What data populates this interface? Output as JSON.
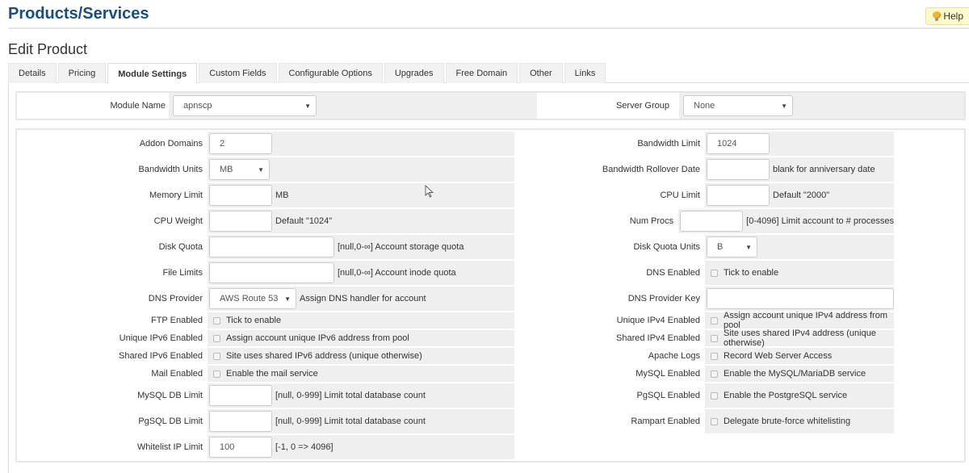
{
  "header": {
    "title": "Products/Services",
    "help_label": "Help",
    "subtitle": "Edit Product"
  },
  "tabs": [
    {
      "label": "Details",
      "active": false
    },
    {
      "label": "Pricing",
      "active": false
    },
    {
      "label": "Module Settings",
      "active": true
    },
    {
      "label": "Custom Fields",
      "active": false
    },
    {
      "label": "Configurable Options",
      "active": false
    },
    {
      "label": "Upgrades",
      "active": false
    },
    {
      "label": "Free Domain",
      "active": false
    },
    {
      "label": "Other",
      "active": false
    },
    {
      "label": "Links",
      "active": false
    }
  ],
  "module": {
    "module_name_label": "Module Name",
    "module_name_value": "apnscp",
    "server_group_label": "Server Group",
    "server_group_value": "None"
  },
  "left_fields": {
    "addon_domains": {
      "label": "Addon Domains",
      "value": "2"
    },
    "bandwidth_units": {
      "label": "Bandwidth Units",
      "value": "MB"
    },
    "memory_limit": {
      "label": "Memory Limit",
      "value": "",
      "hint": "MB"
    },
    "cpu_weight": {
      "label": "CPU Weight",
      "value": "",
      "hint": "Default \"1024\""
    },
    "disk_quota": {
      "label": "Disk Quota",
      "value": "",
      "hint": "[null,0-∞] Account storage quota"
    },
    "file_limits": {
      "label": "File Limits",
      "value": "",
      "hint": "[null,0-∞] Account inode quota"
    },
    "dns_provider": {
      "label": "DNS Provider",
      "value": "AWS Route 53",
      "hint": "Assign DNS handler for account"
    },
    "ftp_enabled": {
      "label": "FTP Enabled",
      "checked": false,
      "hint": "Tick to enable"
    },
    "unique_ipv6": {
      "label": "Unique IPv6 Enabled",
      "checked": false,
      "hint": "Assign account unique IPv6 address from pool"
    },
    "shared_ipv6": {
      "label": "Shared IPv6 Enabled",
      "checked": false,
      "hint": "Site uses shared IPv6 address (unique otherwise)"
    },
    "mail_enabled": {
      "label": "Mail Enabled",
      "checked": false,
      "hint": "Enable the mail service"
    },
    "mysql_db_limit": {
      "label": "MySQL DB Limit",
      "value": "",
      "hint": "[null, 0-999] Limit total database count"
    },
    "pgsql_db_limit": {
      "label": "PgSQL DB Limit",
      "value": "",
      "hint": "[null, 0-999] Limit total database count"
    },
    "whitelist_ip_limit": {
      "label": "Whitelist IP Limit",
      "value": "100",
      "hint": "[-1, 0 => 4096]"
    }
  },
  "right_fields": {
    "bandwidth_limit": {
      "label": "Bandwidth Limit",
      "value": "1024"
    },
    "bandwidth_rollover": {
      "label": "Bandwidth Rollover Date",
      "value": "",
      "hint": "blank for anniversary date"
    },
    "cpu_limit": {
      "label": "CPU Limit",
      "value": "",
      "hint": "Default \"2000\""
    },
    "num_procs": {
      "label": "Num Procs",
      "value": "",
      "hint": "[0-4096] Limit account to # processes"
    },
    "disk_quota_units": {
      "label": "Disk Quota Units",
      "value": "B"
    },
    "dns_enabled": {
      "label": "DNS Enabled",
      "checked": false,
      "hint": "Tick to enable"
    },
    "dns_provider_key": {
      "label": "DNS Provider Key",
      "value": ""
    },
    "unique_ipv4": {
      "label": "Unique IPv4 Enabled",
      "checked": false,
      "hint": "Assign account unique IPv4 address from pool"
    },
    "shared_ipv4": {
      "label": "Shared IPv4 Enabled",
      "checked": false,
      "hint": "Site uses shared IPv4 address (unique otherwise)"
    },
    "apache_logs": {
      "label": "Apache Logs",
      "checked": false,
      "hint": "Record Web Server Access"
    },
    "mysql_enabled": {
      "label": "MySQL Enabled",
      "checked": false,
      "hint": "Enable the MySQL/MariaDB service"
    },
    "pgsql_enabled": {
      "label": "PgSQL Enabled",
      "checked": false,
      "hint": "Enable the PostgreSQL service"
    },
    "rampart_enabled": {
      "label": "Rampart Enabled",
      "checked": false,
      "hint": "Delegate brute-force whitelisting"
    }
  }
}
